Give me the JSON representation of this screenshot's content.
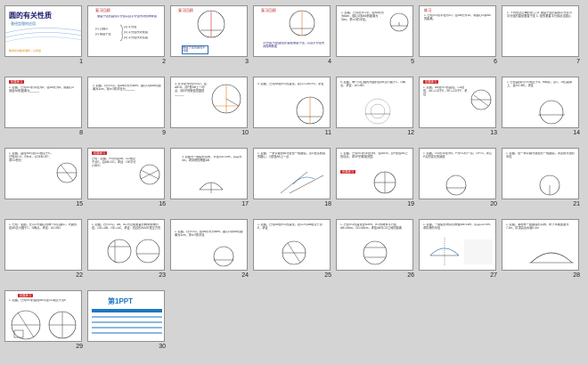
{
  "app": {
    "view": "Slide Sorter"
  },
  "slides": [
    {
      "n": "1",
      "title": "圆的有关性质",
      "subtitle": "垂径定理的应用",
      "footer": "数学初中数学课件—九年级"
    },
    {
      "n": "2",
      "title": "复习回顾",
      "text": "垂直于弦的直径平分弦并且平分弦所对的两条弧",
      "items": [
        "(1) 过圆心",
        "(2) 垂直于弦",
        "(3) 平分弦",
        "(4) 平分弦所对优弧",
        "(5) 平分弦所对劣弧"
      ]
    },
    {
      "n": "3",
      "title": "复习回顾",
      "text": "垂直于弦的直径平分弦"
    },
    {
      "n": "4",
      "title": "复习回顾",
      "text": "平分弦(不是直径)的直径垂直于弦，并且平分弦所对的两条弧"
    },
    {
      "n": "5",
      "title": "例题",
      "text": "1. 如图，已知在⊙O中，弦AB的长为8cm，圆心O到AB的距离为3cm，求⊙O的半径。"
    },
    {
      "n": "6",
      "title": "练习",
      "text": "1. 已知⊙O的半径为10，弦AB长为16，求圆心O到AB的距离。"
    },
    {
      "n": "7",
      "title": "练习",
      "text": "1. 下列说法正确的是 (  )  A. 垂直于弦的直线平分弦  B. 平分弦的直径垂直于弦  C. 弦的垂直平分线必过圆心"
    },
    {
      "n": "8",
      "title": "拓展练习",
      "text": "1. 如图，已知⊙O的半径为5，弦AB长为8，则圆心O到弦AB的距离为______"
    },
    {
      "n": "9",
      "title": "",
      "text": "2. 如图，在⊙O中，弦AB的长为8cm，圆心O到AB的距离为3cm，则⊙O的半径为______"
    },
    {
      "n": "10",
      "title": "",
      "text": "3. 在半径为5的⊙O中，弦AB=8，点P是AB上一动点，则OP的取值范围是______"
    },
    {
      "n": "11",
      "title": "",
      "text": "4. 如图，已知AB是⊙O的直径，弦CD⊥AB于E，求证"
    },
    {
      "n": "12",
      "title": "",
      "text": "5. 如图，两个同心圆的大圆的弦AB交小圆于C、D两点，求证：AC=BD"
    },
    {
      "n": "13",
      "title": "拓展练习",
      "text": "1. 如图，AB是⊙O的直径，CD是弦，AE⊥CD于E，BF⊥CD于F，求证"
    },
    {
      "n": "14",
      "title": "",
      "text": "1. 已知直线l与⊙O相交于A、B两点，点C、D在直线l上，且AC=BD，求证"
    },
    {
      "n": "15",
      "title": "",
      "text": "1. 如图，直径AB与弦CD相交于E，已知AE=2，EB=6，∠DEB=30°，求CD的长"
    },
    {
      "n": "16",
      "title": "拓展练习",
      "text": "已知：如图，⊙O的弦AB、CD相交于点E，且AB=CD，求证：OE平分∠BED"
    },
    {
      "n": "17",
      "title": "",
      "text": "3. 如图为一圆弧形拱桥，半径OA=10m，拱高为4m，求拱桥的跨度AB"
    },
    {
      "n": "18",
      "title": "",
      "text": "1. 如图，一条公路的转弯处是一段圆弧，点O是这段弧的圆心，C是弧AB上一点"
    },
    {
      "n": "19",
      "title": "拓展练习",
      "text": "1. 如图，已知⊙O的半径为5，弦AB=8，点P是弦AB上的动点，求OP的取值范围"
    },
    {
      "n": "20",
      "title": "",
      "text": "1. 如图，⊙O的半径为5，P为⊙O内一点，OP=3，求过P点的弦长的最值"
    },
    {
      "n": "21",
      "title": "",
      "text": "1. 如图，是一条公路弯道处的一段圆弧，求这段弯道的半径"
    },
    {
      "n": "22",
      "title": "",
      "text": "1. 已知：如图，在以O为圆心的两个同心圆中，大圆的弦AB交小圆于C、D两点。求证：AC=BD"
    },
    {
      "n": "23",
      "title": "",
      "text": "1. 如图，在⊙O中，AB、AC为互相垂直的两条相等的弦，OD⊥AB，OE⊥AC，求证：四边形ADOE是正方形"
    },
    {
      "n": "24",
      "title": "",
      "text": "1. 如图，在⊙O中，弦AB的长为8cm，圆心O到AB的距离为3cm，求⊙O的半径"
    },
    {
      "n": "25",
      "title": "",
      "text": "1. 如图，已知AB是⊙O的直径，弦CD与AB相交于点E，求证"
    },
    {
      "n": "26",
      "title": "",
      "text": "1. 已知⊙O的直径是50cm，⊙O的两条平行弦AB=40cm，CD=48cm，求弦AB与CD之间的距离"
    },
    {
      "n": "27",
      "title": "",
      "text": "1. 如图，一圆弧形桥拱的跨度AB=16m，拱高CD=4m，求拱桥的半径"
    },
    {
      "n": "28",
      "title": "",
      "text": "1. 如图，某地有一座圆弧形拱桥，桥下水面宽度为7.2m，拱顶高出水面2.4m"
    },
    {
      "n": "29",
      "title": "拓展练习",
      "text": "1. 如图，已知⊙O的直径AB与弦CD相交于点E"
    },
    {
      "n": "30",
      "title": "",
      "logo": "第1PPT"
    }
  ],
  "colors": {
    "accent": "#c0181a",
    "tag_red": "#cc2222",
    "tag_blue": "#2b6fb0",
    "circle": "#333333",
    "highlight": "#e07a1a"
  }
}
